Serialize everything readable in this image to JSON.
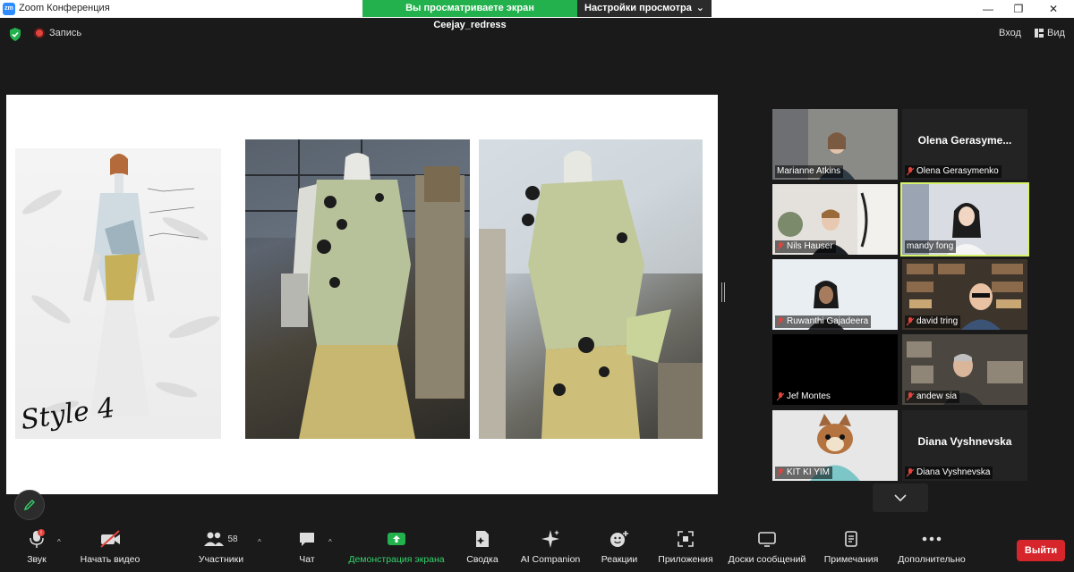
{
  "window": {
    "app_logo": "zm",
    "title": "Zoom Конференция",
    "minimize": "—",
    "restore": "❐",
    "close": "✕"
  },
  "share_banner": {
    "viewing_text": "Вы просматриваете экран Ceejay_redress",
    "view_options": "Настройки просмотра",
    "caret": "⌄"
  },
  "topbar": {
    "recording": "Запись",
    "enter": "Вход",
    "view": "Вид"
  },
  "slide": {
    "style_label": "Style 4"
  },
  "participants": [
    {
      "name": "Marianne Atkins",
      "muted": false,
      "video": true
    },
    {
      "name": "Olena Gerasymenko",
      "big_name": "Olena  Gerasyme...",
      "muted": true,
      "video": false
    },
    {
      "name": "Nils Hauser",
      "muted": true,
      "video": true
    },
    {
      "name": "mandy fong",
      "muted": false,
      "video": true,
      "active_speaker": true
    },
    {
      "name": "Ruwanthi Gajadeera",
      "muted": true,
      "video": true
    },
    {
      "name": "david tring",
      "muted": true,
      "video": true
    },
    {
      "name": "Jef Montes",
      "muted": true,
      "video": false
    },
    {
      "name": "andew sia",
      "muted": true,
      "video": true
    },
    {
      "name": "KIT KI YIM",
      "muted": true,
      "video": true
    },
    {
      "name": "Diana Vyshnevska",
      "big_name": "Diana Vyshnevska",
      "muted": true,
      "video": false
    }
  ],
  "toolbar": {
    "audio": "Звук",
    "audio_badge": "!",
    "video": "Начать видео",
    "participants": "Участники",
    "participants_count": "58",
    "chat": "Чат",
    "share": "Демонстрация экрана",
    "summary": "Сводка",
    "ai_companion": "AI Companion",
    "reactions": "Реакции",
    "apps": "Приложения",
    "whiteboards": "Доски сообщений",
    "notes": "Примечания",
    "more": "Дополнительно",
    "leave": "Выйти",
    "caret": "^"
  },
  "colors": {
    "share_green": "#23b14d",
    "active_speaker": "#d6f26a",
    "leave_red": "#d7262b",
    "share_label_green": "#33d36b"
  }
}
